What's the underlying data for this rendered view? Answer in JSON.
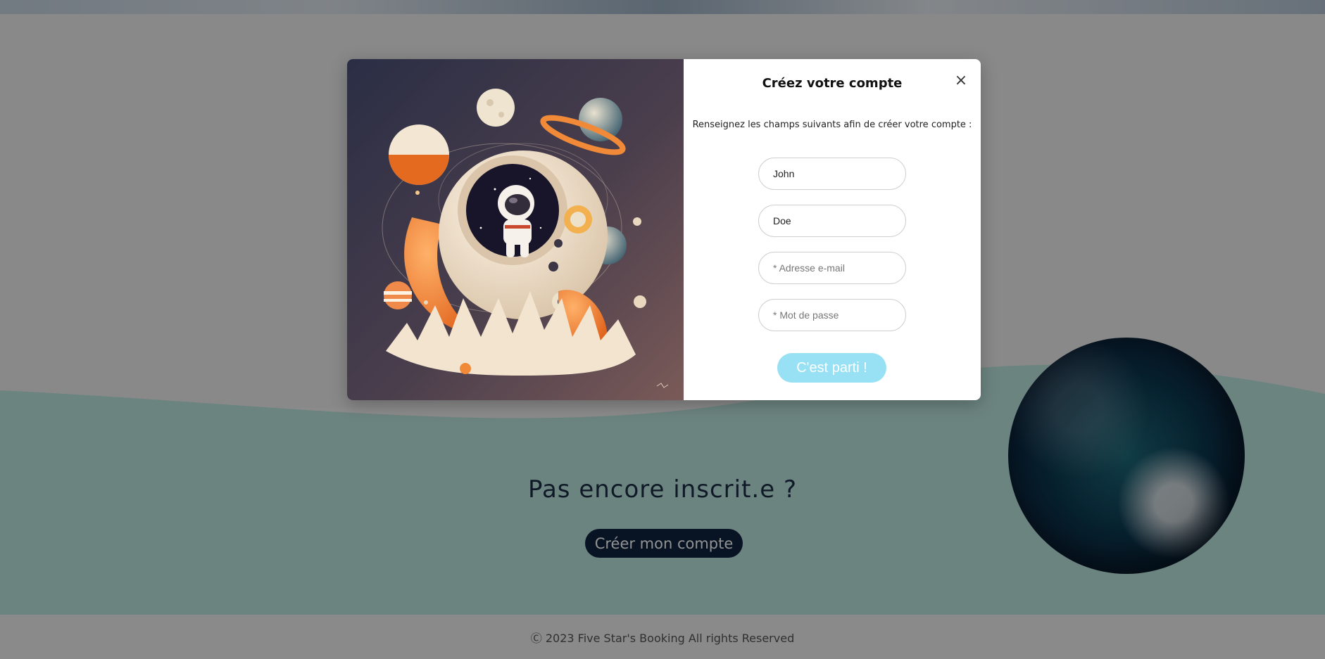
{
  "modal": {
    "title": "Créez votre compte",
    "close_label": "×",
    "description": "Renseignez les champs suivants afin de créer votre compte :",
    "fields": {
      "first_name_value": "John",
      "last_name_value": "Doe",
      "email_placeholder": "* Adresse e-mail",
      "password_placeholder": "* Mot de passe"
    },
    "submit_label": "C'est parti !"
  },
  "cta": {
    "title": "Pas encore inscrit.e ?",
    "button_label": "Créer mon compte"
  },
  "footer": {
    "copyright": "Ⓒ 2023 Five Star's Booking All rights Reserved"
  },
  "colors": {
    "overlay": "#000000",
    "teal_wave": "#bfe8df",
    "cta_navy": "#0f2240",
    "submit_light_blue": "#98e0f4"
  },
  "icons": {
    "close": "close-icon"
  }
}
